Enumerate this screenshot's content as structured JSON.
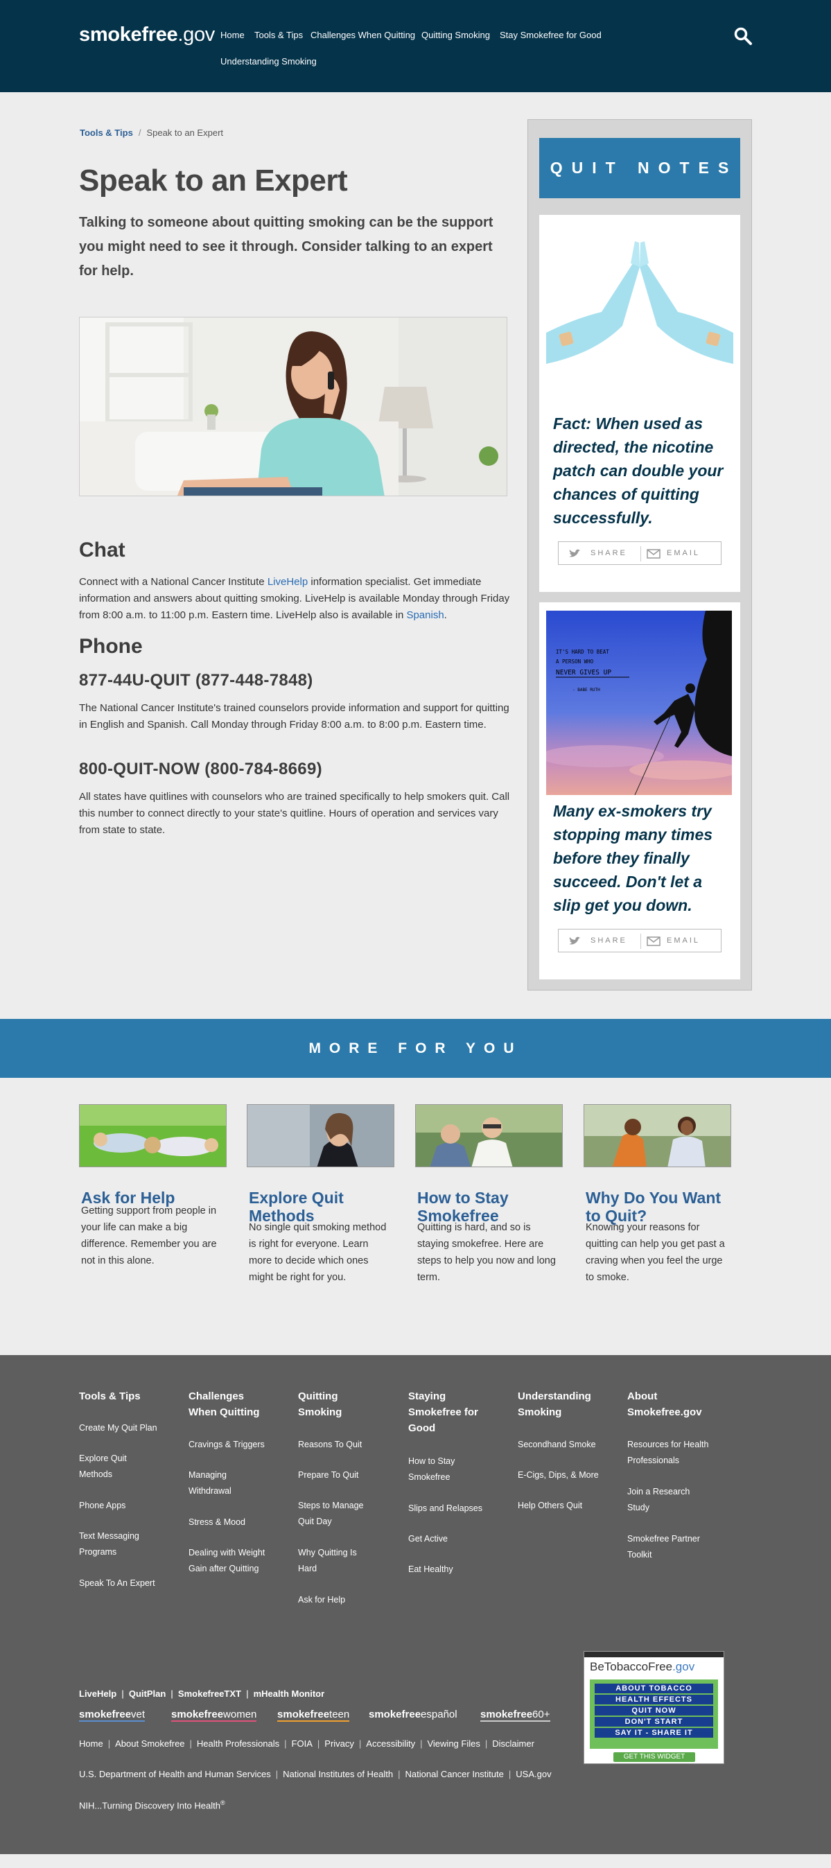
{
  "header": {
    "logo_bold": "smokefree",
    "logo_suffix": ".gov",
    "nav": [
      "Home",
      "Tools & Tips",
      "Challenges When Quitting",
      "Quitting Smoking",
      "Stay Smokefree for Good",
      "Understanding Smoking"
    ],
    "search_icon": "search-icon"
  },
  "breadcrumb": {
    "link": "Tools & Tips",
    "separator": "/",
    "current": "Speak to an Expert"
  },
  "main": {
    "title": "Speak to an Expert",
    "intro": "Talking to someone about quitting smoking can be the support you might need to see it through. Consider talking to an expert for help.",
    "chat_heading": "Chat",
    "chat_p1": "Connect with a National Cancer Institute ",
    "chat_link1": "LiveHelp",
    "chat_p2": " information specialist. Get immediate information and answers about quitting smoking. LiveHelp is available Monday through Friday from 8:00 a.m. to 11:00 p.m. Eastern time. LiveHelp also is available in ",
    "chat_link2": "Spanish",
    "chat_p3": ".",
    "phone_heading": "Phone",
    "phone1": "877-44U-QUIT (877-448-7848)",
    "phone1_text": "The National Cancer Institute's trained counselors provide information and support for quitting in English and Spanish. Call Monday through Friday 8:00 a.m. to 8:00 p.m. Eastern time.",
    "phone2": "800-QUIT-NOW (800-784-8669)",
    "phone2_text": "All states have quitlines with counselors who are trained specifically to help smokers quit. Call this number to connect directly to your state's quitline. Hours of operation and services vary from state to state."
  },
  "sidebar": {
    "title": "QUIT NOTES",
    "card1_text": "Fact: When used as directed, the nicotine patch can double your chances of quitting successfully.",
    "card2_text": "Many ex-smokers try stopping many times before they finally succeed. Don't let a slip get you down.",
    "poster_lines": [
      "IT'S HARD TO BEAT",
      "A PERSON WHO",
      "NEVER GIVES UP",
      "- BABE RUTH"
    ],
    "share_label": "SHARE",
    "email_label": "EMAIL"
  },
  "more": {
    "heading": "MORE FOR YOU",
    "items": [
      {
        "title": "Ask for Help",
        "text": "Getting support from people in your life can make a big difference. Remember you are not in this alone."
      },
      {
        "title": "Explore Quit Methods",
        "text": "No single quit smoking method is right for everyone. Learn more to decide which ones might be right for you."
      },
      {
        "title": "How to Stay Smokefree",
        "text": "Quitting is hard, and so is staying smokefree. Here are steps to help you now and long term."
      },
      {
        "title": "Why Do You Want to Quit?",
        "text": "Knowing your reasons for quitting can help you get past a craving when you feel the urge to smoke."
      }
    ]
  },
  "footer": {
    "cols": [
      {
        "heading": "Tools & Tips",
        "links": [
          "Create My Quit Plan",
          "Explore Quit Methods",
          "Phone Apps",
          "Text Messaging Programs",
          "Speak To An Expert"
        ]
      },
      {
        "heading": "Challenges When Quitting",
        "links": [
          "Cravings & Triggers",
          "Managing Withdrawal",
          "Stress & Mood",
          "Dealing with Weight Gain after Quitting"
        ]
      },
      {
        "heading": "Quitting Smoking",
        "links": [
          "Reasons To Quit",
          "Prepare To Quit",
          "Steps to Manage Quit Day",
          "Why Quitting Is Hard",
          "Ask for Help"
        ]
      },
      {
        "heading": "Staying Smokefree for Good",
        "links": [
          "How to Stay Smokefree",
          "Slips and Relapses",
          "Get Active",
          "Eat Healthy"
        ]
      },
      {
        "heading": "Understanding Smoking",
        "links": [
          "Secondhand Smoke",
          "E-Cigs, Dips, & More",
          "Help Others Quit"
        ]
      },
      {
        "heading": "About Smokefree.gov",
        "links": [
          "Resources for Health Professionals",
          "Join a Research Study",
          "Smokefree Partner Toolkit"
        ]
      }
    ],
    "row1": [
      "LiveHelp",
      "QuitPlan",
      "SmokefreeTXT",
      "mHealth Monitor"
    ],
    "brands": [
      {
        "bold": "smokefree",
        "rest": "vet",
        "color": "#5b8fd1"
      },
      {
        "bold": "smokefree",
        "rest": "women",
        "color": "#e0527a"
      },
      {
        "bold": "smokefree",
        "rest": "teen",
        "color": "#f0a030"
      },
      {
        "bold": "smokefree",
        "rest": "español",
        "color": "#cccccc"
      },
      {
        "bold": "smokefree",
        "rest": "60+",
        "color": "#cccccc"
      }
    ],
    "row3": [
      "Home",
      "About Smokefree",
      "Health Professionals",
      "FOIA",
      "Privacy",
      "Accessibility",
      "Viewing Files",
      "Disclaimer"
    ],
    "row4": [
      "U.S. Department of Health and Human Services",
      "National Institutes of Health",
      "National Cancer Institute",
      "USA.gov"
    ],
    "row5": "NIH...Turning Discovery Into Health",
    "row5_sup": "®",
    "widget": {
      "title_a": "BeTobaccoFree",
      "title_b": ".gov",
      "buttons": [
        "ABOUT TOBACCO",
        "HEALTH EFFECTS",
        "QUIT NOW",
        "DON'T START",
        "SAY IT - SHARE IT"
      ],
      "cta": "GET THIS WIDGET"
    }
  }
}
